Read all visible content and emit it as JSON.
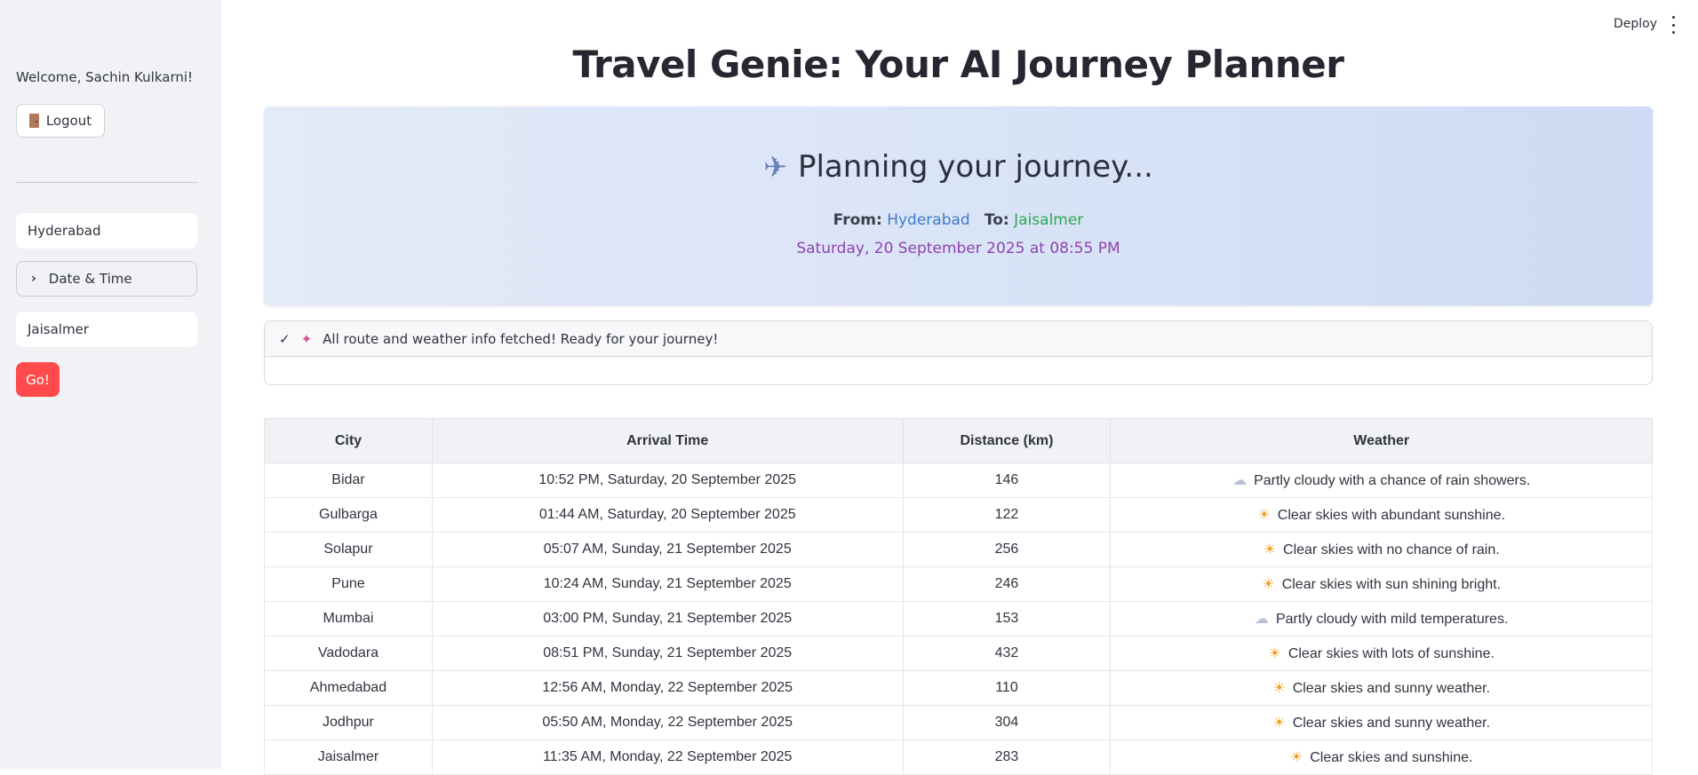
{
  "sidebar": {
    "welcome": "Welcome, Sachin Kulkarni!",
    "logout_label": "Logout",
    "origin_value": "Hyderabad",
    "datetime_label": "Date & Time",
    "destination_value": "Jaisalmer",
    "go_label": "Go!"
  },
  "header": {
    "deploy_label": "Deploy"
  },
  "main": {
    "title": "Travel Genie: Your AI Journey Planner",
    "banner": {
      "heading": "Planning your journey...",
      "from_label": "From:",
      "from_value": "Hyderabad",
      "to_label": "To:",
      "to_value": "Jaisalmer",
      "datetime": "Saturday, 20 September 2025 at 08:55 PM"
    },
    "status_message": "All route and weather info fetched! Ready for your journey!",
    "table": {
      "columns": [
        "City",
        "Arrival Time",
        "Distance (km)",
        "Weather"
      ],
      "rows": [
        {
          "city": "Bidar",
          "arrival": "10:52 PM, Saturday, 20 September 2025",
          "distance": "146",
          "icon": "cloud-icon",
          "weather": "Partly cloudy with a chance of rain showers."
        },
        {
          "city": "Gulbarga",
          "arrival": "01:44 AM, Saturday, 20 September 2025",
          "distance": "122",
          "icon": "sun-icon",
          "weather": "Clear skies with abundant sunshine."
        },
        {
          "city": "Solapur",
          "arrival": "05:07 AM, Sunday, 21 September 2025",
          "distance": "256",
          "icon": "sun-icon",
          "weather": "Clear skies with no chance of rain."
        },
        {
          "city": "Pune",
          "arrival": "10:24 AM, Sunday, 21 September 2025",
          "distance": "246",
          "icon": "sun-icon",
          "weather": "Clear skies with sun shining bright."
        },
        {
          "city": "Mumbai",
          "arrival": "03:00 PM, Sunday, 21 September 2025",
          "distance": "153",
          "icon": "cloud-icon",
          "weather": "Partly cloudy with mild temperatures."
        },
        {
          "city": "Vadodara",
          "arrival": "08:51 PM, Sunday, 21 September 2025",
          "distance": "432",
          "icon": "sun-icon",
          "weather": "Clear skies with lots of sunshine."
        },
        {
          "city": "Ahmedabad",
          "arrival": "12:56 AM, Monday, 22 September 2025",
          "distance": "110",
          "icon": "sun-icon",
          "weather": "Clear skies and sunny weather."
        },
        {
          "city": "Jodhpur",
          "arrival": "05:50 AM, Monday, 22 September 2025",
          "distance": "304",
          "icon": "sun-icon",
          "weather": "Clear skies and sunny weather."
        },
        {
          "city": "Jaisalmer",
          "arrival": "11:35 AM, Monday, 22 September 2025",
          "distance": "283",
          "icon": "sun-icon",
          "weather": "Clear skies and sunshine."
        }
      ]
    }
  },
  "colors": {
    "accent": "#ff4b4b",
    "from": "#3d7cc9",
    "to": "#2ea84f",
    "datetime": "#8e44ad"
  }
}
